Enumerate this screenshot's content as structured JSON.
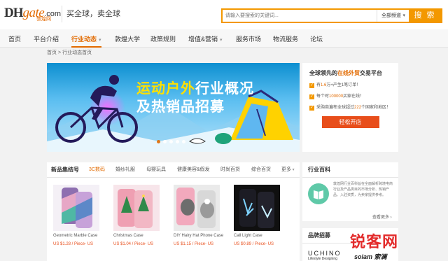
{
  "header": {
    "logo_dh": "DH",
    "logo_gate": "gate",
    "logo_com": ".com",
    "logo_sub": "敦煌网",
    "slogan": "买全球，卖全球",
    "search_placeholder": "请输入要搜索的关键词...",
    "search_category": "全部频道",
    "search_button": "搜 索"
  },
  "nav": {
    "items": [
      "首页",
      "平台介绍",
      "行业动态",
      "敦煌大学",
      "政策规则",
      "增值&营销",
      "服务市场",
      "物流服务",
      "论坛"
    ]
  },
  "breadcrumb": {
    "home": "首页",
    "sep": ">",
    "current": "行业动态首页"
  },
  "banner": {
    "line1_a": "运动户外",
    "line1_b": "行业概况",
    "line2": "及热销品招募"
  },
  "promo": {
    "title_a": "全球领先的",
    "title_hl": "在线外贸",
    "title_b": "交易平台",
    "items": [
      {
        "a": "有",
        "num": "1.6",
        "b": "万+产生1笔订单！"
      },
      {
        "a": "每个时",
        "num": "100000",
        "b": "买家在线！"
      },
      {
        "a": "采购商遍布全球超过",
        "num": "222",
        "b": "个国家和地区！"
      }
    ],
    "button": "轻松开店"
  },
  "products": {
    "tabs": [
      "新品集结号",
      "3C数码",
      "婚纱礼服",
      "母婴玩具",
      "健康美容&假发",
      "时尚百货",
      "综合百货",
      "更多"
    ],
    "items": [
      {
        "name": "Geometric Marble Case",
        "price": "US $1.28 / Piece- US"
      },
      {
        "name": "Christmas Case",
        "price": "US $1.04 / Piece- US"
      },
      {
        "name": "DIY Hairy Hat Phone Case",
        "price": "US $1.15 / Piece- US"
      },
      {
        "name": "Call Light Case",
        "price": "US $0.89 / Piece- US"
      }
    ]
  },
  "wiki": {
    "title": "行业百科",
    "text": "敦煌网行业百科旨在全面解析跨境电商行业及产品类目的市场分析、热销产品、入驻资质，为卖家提供参考。",
    "more": "查看更多 ›"
  },
  "brands": {
    "title": "品牌招募",
    "brand1": "UCHINO",
    "brand1_sub": "Lifestyle Designing",
    "brand2": "solam 索澜"
  },
  "watermark": {
    "red": "锐客网"
  }
}
